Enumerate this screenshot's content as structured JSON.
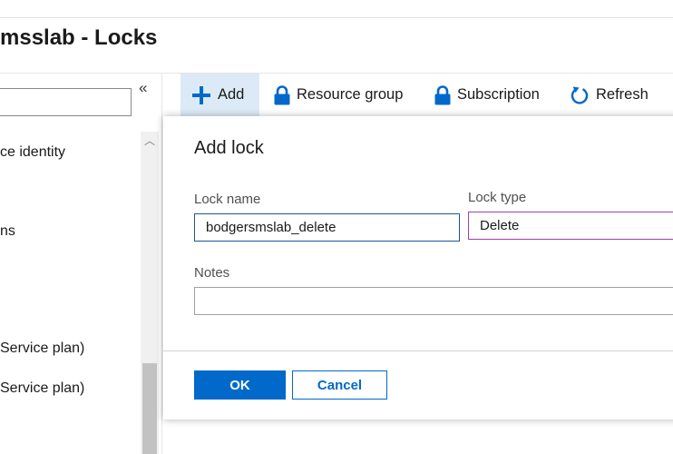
{
  "header": {
    "title": "msslab - Locks"
  },
  "sidebar": {
    "collapse_glyph": "«",
    "items": [
      {
        "label": "ce identity"
      },
      {
        "label": "ns"
      },
      {
        "label": "Service plan)"
      },
      {
        "label": " Service plan)"
      }
    ]
  },
  "toolbar": {
    "add_label": "Add",
    "resource_group_label": "Resource group",
    "subscription_label": "Subscription",
    "refresh_label": "Refresh",
    "icons": [
      "plus-icon",
      "lock-icon",
      "lock-icon",
      "refresh-icon"
    ]
  },
  "dialog": {
    "title": "Add lock",
    "lock_name_label": "Lock name",
    "lock_name_value": "bodgersmslab_delete",
    "lock_type_label": "Lock type",
    "lock_type_value": "Delete",
    "notes_label": "Notes",
    "notes_value": "",
    "ok_label": "OK",
    "cancel_label": "Cancel"
  },
  "colors": {
    "accent": "#0069c9",
    "active_toolbar_bg": "#dbeaf6",
    "focused_border": "#1e5799",
    "select_border": "#a23fb0"
  }
}
